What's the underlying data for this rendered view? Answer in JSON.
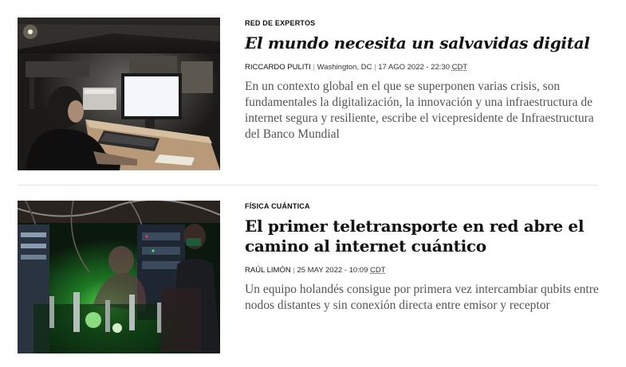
{
  "articles": [
    {
      "kicker": "RED DE EXPERTOS",
      "headline": "El mundo necesita un salvavidas digital",
      "author": "RICCARDO PULITI",
      "separator": "|",
      "location": "Washington, DC",
      "date": "17 AGO 2022 - 22:30",
      "timezone": "CDT",
      "summary": "En un contexto global en el que se superponen varias crisis, son fundamentales la digitalización, la innovación y una infraestructura de internet segura y resiliente, escribe el vicepresidente de Infraestructura del Banco Mundial"
    },
    {
      "kicker": "FÍSICA CUÁNTICA",
      "headline": "El primer teletransporte en red abre el camino al internet cuántico",
      "author": "RAÚL LIMÓN",
      "separator": "|",
      "date": "25 MAY 2022 - 10:09",
      "timezone": "CDT",
      "summary": "Un equipo holandés consigue por primera vez intercambiar qubits entre nodos distantes y sin conexión directa entre emisor y receptor"
    }
  ],
  "colors": {
    "text": "#111111",
    "summary": "#555555",
    "divider": "#e4e4e4"
  }
}
